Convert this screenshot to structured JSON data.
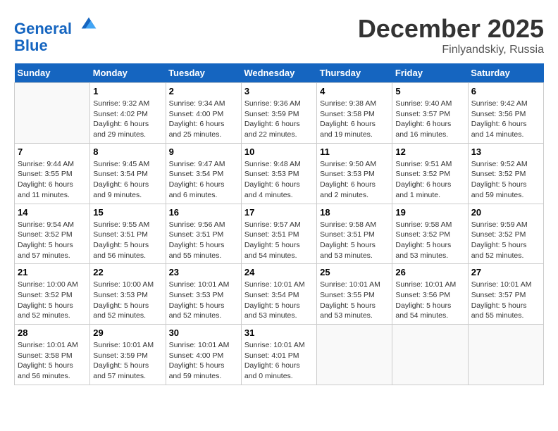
{
  "header": {
    "logo_line1": "General",
    "logo_line2": "Blue",
    "month": "December 2025",
    "location": "Finlyandskiy, Russia"
  },
  "weekdays": [
    "Sunday",
    "Monday",
    "Tuesday",
    "Wednesday",
    "Thursday",
    "Friday",
    "Saturday"
  ],
  "weeks": [
    [
      {
        "day": "",
        "sunrise": "",
        "sunset": "",
        "daylight": ""
      },
      {
        "day": "1",
        "sunrise": "Sunrise: 9:32 AM",
        "sunset": "Sunset: 4:02 PM",
        "daylight": "Daylight: 6 hours and 29 minutes."
      },
      {
        "day": "2",
        "sunrise": "Sunrise: 9:34 AM",
        "sunset": "Sunset: 4:00 PM",
        "daylight": "Daylight: 6 hours and 25 minutes."
      },
      {
        "day": "3",
        "sunrise": "Sunrise: 9:36 AM",
        "sunset": "Sunset: 3:59 PM",
        "daylight": "Daylight: 6 hours and 22 minutes."
      },
      {
        "day": "4",
        "sunrise": "Sunrise: 9:38 AM",
        "sunset": "Sunset: 3:58 PM",
        "daylight": "Daylight: 6 hours and 19 minutes."
      },
      {
        "day": "5",
        "sunrise": "Sunrise: 9:40 AM",
        "sunset": "Sunset: 3:57 PM",
        "daylight": "Daylight: 6 hours and 16 minutes."
      },
      {
        "day": "6",
        "sunrise": "Sunrise: 9:42 AM",
        "sunset": "Sunset: 3:56 PM",
        "daylight": "Daylight: 6 hours and 14 minutes."
      }
    ],
    [
      {
        "day": "7",
        "sunrise": "Sunrise: 9:44 AM",
        "sunset": "Sunset: 3:55 PM",
        "daylight": "Daylight: 6 hours and 11 minutes."
      },
      {
        "day": "8",
        "sunrise": "Sunrise: 9:45 AM",
        "sunset": "Sunset: 3:54 PM",
        "daylight": "Daylight: 6 hours and 9 minutes."
      },
      {
        "day": "9",
        "sunrise": "Sunrise: 9:47 AM",
        "sunset": "Sunset: 3:54 PM",
        "daylight": "Daylight: 6 hours and 6 minutes."
      },
      {
        "day": "10",
        "sunrise": "Sunrise: 9:48 AM",
        "sunset": "Sunset: 3:53 PM",
        "daylight": "Daylight: 6 hours and 4 minutes."
      },
      {
        "day": "11",
        "sunrise": "Sunrise: 9:50 AM",
        "sunset": "Sunset: 3:53 PM",
        "daylight": "Daylight: 6 hours and 2 minutes."
      },
      {
        "day": "12",
        "sunrise": "Sunrise: 9:51 AM",
        "sunset": "Sunset: 3:52 PM",
        "daylight": "Daylight: 6 hours and 1 minute."
      },
      {
        "day": "13",
        "sunrise": "Sunrise: 9:52 AM",
        "sunset": "Sunset: 3:52 PM",
        "daylight": "Daylight: 5 hours and 59 minutes."
      }
    ],
    [
      {
        "day": "14",
        "sunrise": "Sunrise: 9:54 AM",
        "sunset": "Sunset: 3:52 PM",
        "daylight": "Daylight: 5 hours and 57 minutes."
      },
      {
        "day": "15",
        "sunrise": "Sunrise: 9:55 AM",
        "sunset": "Sunset: 3:51 PM",
        "daylight": "Daylight: 5 hours and 56 minutes."
      },
      {
        "day": "16",
        "sunrise": "Sunrise: 9:56 AM",
        "sunset": "Sunset: 3:51 PM",
        "daylight": "Daylight: 5 hours and 55 minutes."
      },
      {
        "day": "17",
        "sunrise": "Sunrise: 9:57 AM",
        "sunset": "Sunset: 3:51 PM",
        "daylight": "Daylight: 5 hours and 54 minutes."
      },
      {
        "day": "18",
        "sunrise": "Sunrise: 9:58 AM",
        "sunset": "Sunset: 3:51 PM",
        "daylight": "Daylight: 5 hours and 53 minutes."
      },
      {
        "day": "19",
        "sunrise": "Sunrise: 9:58 AM",
        "sunset": "Sunset: 3:52 PM",
        "daylight": "Daylight: 5 hours and 53 minutes."
      },
      {
        "day": "20",
        "sunrise": "Sunrise: 9:59 AM",
        "sunset": "Sunset: 3:52 PM",
        "daylight": "Daylight: 5 hours and 52 minutes."
      }
    ],
    [
      {
        "day": "21",
        "sunrise": "Sunrise: 10:00 AM",
        "sunset": "Sunset: 3:52 PM",
        "daylight": "Daylight: 5 hours and 52 minutes."
      },
      {
        "day": "22",
        "sunrise": "Sunrise: 10:00 AM",
        "sunset": "Sunset: 3:53 PM",
        "daylight": "Daylight: 5 hours and 52 minutes."
      },
      {
        "day": "23",
        "sunrise": "Sunrise: 10:01 AM",
        "sunset": "Sunset: 3:53 PM",
        "daylight": "Daylight: 5 hours and 52 minutes."
      },
      {
        "day": "24",
        "sunrise": "Sunrise: 10:01 AM",
        "sunset": "Sunset: 3:54 PM",
        "daylight": "Daylight: 5 hours and 53 minutes."
      },
      {
        "day": "25",
        "sunrise": "Sunrise: 10:01 AM",
        "sunset": "Sunset: 3:55 PM",
        "daylight": "Daylight: 5 hours and 53 minutes."
      },
      {
        "day": "26",
        "sunrise": "Sunrise: 10:01 AM",
        "sunset": "Sunset: 3:56 PM",
        "daylight": "Daylight: 5 hours and 54 minutes."
      },
      {
        "day": "27",
        "sunrise": "Sunrise: 10:01 AM",
        "sunset": "Sunset: 3:57 PM",
        "daylight": "Daylight: 5 hours and 55 minutes."
      }
    ],
    [
      {
        "day": "28",
        "sunrise": "Sunrise: 10:01 AM",
        "sunset": "Sunset: 3:58 PM",
        "daylight": "Daylight: 5 hours and 56 minutes."
      },
      {
        "day": "29",
        "sunrise": "Sunrise: 10:01 AM",
        "sunset": "Sunset: 3:59 PM",
        "daylight": "Daylight: 5 hours and 57 minutes."
      },
      {
        "day": "30",
        "sunrise": "Sunrise: 10:01 AM",
        "sunset": "Sunset: 4:00 PM",
        "daylight": "Daylight: 5 hours and 59 minutes."
      },
      {
        "day": "31",
        "sunrise": "Sunrise: 10:01 AM",
        "sunset": "Sunset: 4:01 PM",
        "daylight": "Daylight: 6 hours and 0 minutes."
      },
      {
        "day": "",
        "sunrise": "",
        "sunset": "",
        "daylight": ""
      },
      {
        "day": "",
        "sunrise": "",
        "sunset": "",
        "daylight": ""
      },
      {
        "day": "",
        "sunrise": "",
        "sunset": "",
        "daylight": ""
      }
    ]
  ]
}
